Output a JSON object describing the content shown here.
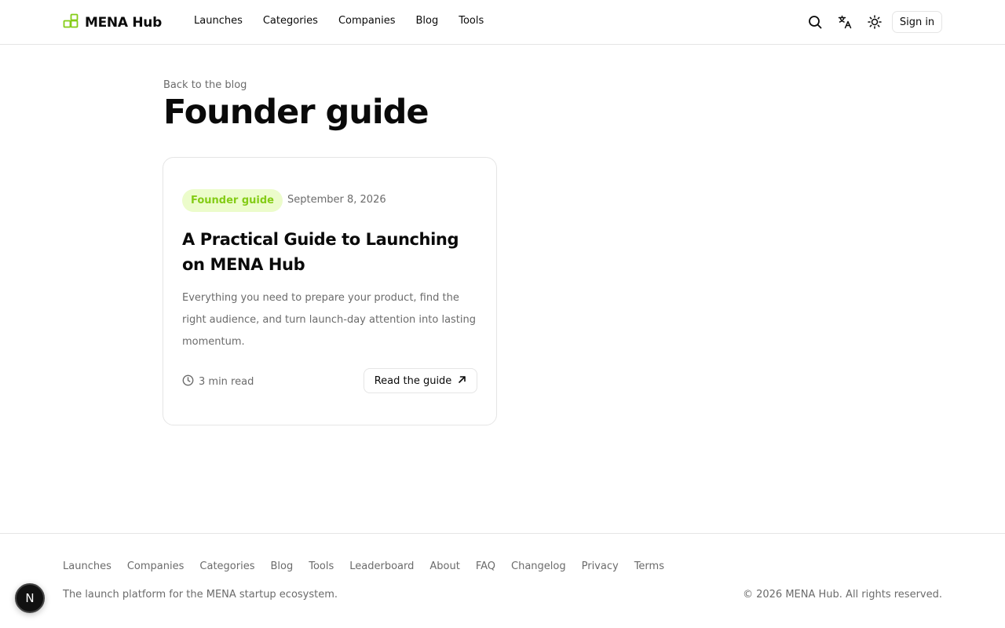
{
  "header": {
    "brand": "MENA Hub",
    "nav": [
      "Launches",
      "Categories",
      "Companies",
      "Blog",
      "Tools"
    ],
    "icons": [
      "search-icon",
      "translate-icon",
      "sun-icon"
    ],
    "sign_in": "Sign in"
  },
  "main": {
    "back_link": "Back to the blog",
    "title": "Founder guide",
    "card": {
      "badge": "Founder guide",
      "date": "September 8, 2026",
      "title": "A Practical Guide to Launching on MENA Hub",
      "description": "Everything you need to prepare your product, find the right audience, and turn launch-day attention into lasting momentum.",
      "read_time": "3 min read",
      "cta": "Read the guide"
    }
  },
  "footer": {
    "links": [
      "Launches",
      "Companies",
      "Categories",
      "Blog",
      "Tools",
      "Leaderboard",
      "About",
      "FAQ",
      "Changelog",
      "Privacy",
      "Terms"
    ],
    "tagline": "The launch platform for the MENA startup ecosystem.",
    "copyright": "© 2026 MENA Hub. All rights reserved."
  },
  "dev_badge": "N",
  "colors": {
    "accent": "#84cc16",
    "badge_bg": "#ecfccb",
    "text": "#0a0a0a",
    "muted": "#6b6b6b",
    "border": "#e5e5e5"
  }
}
